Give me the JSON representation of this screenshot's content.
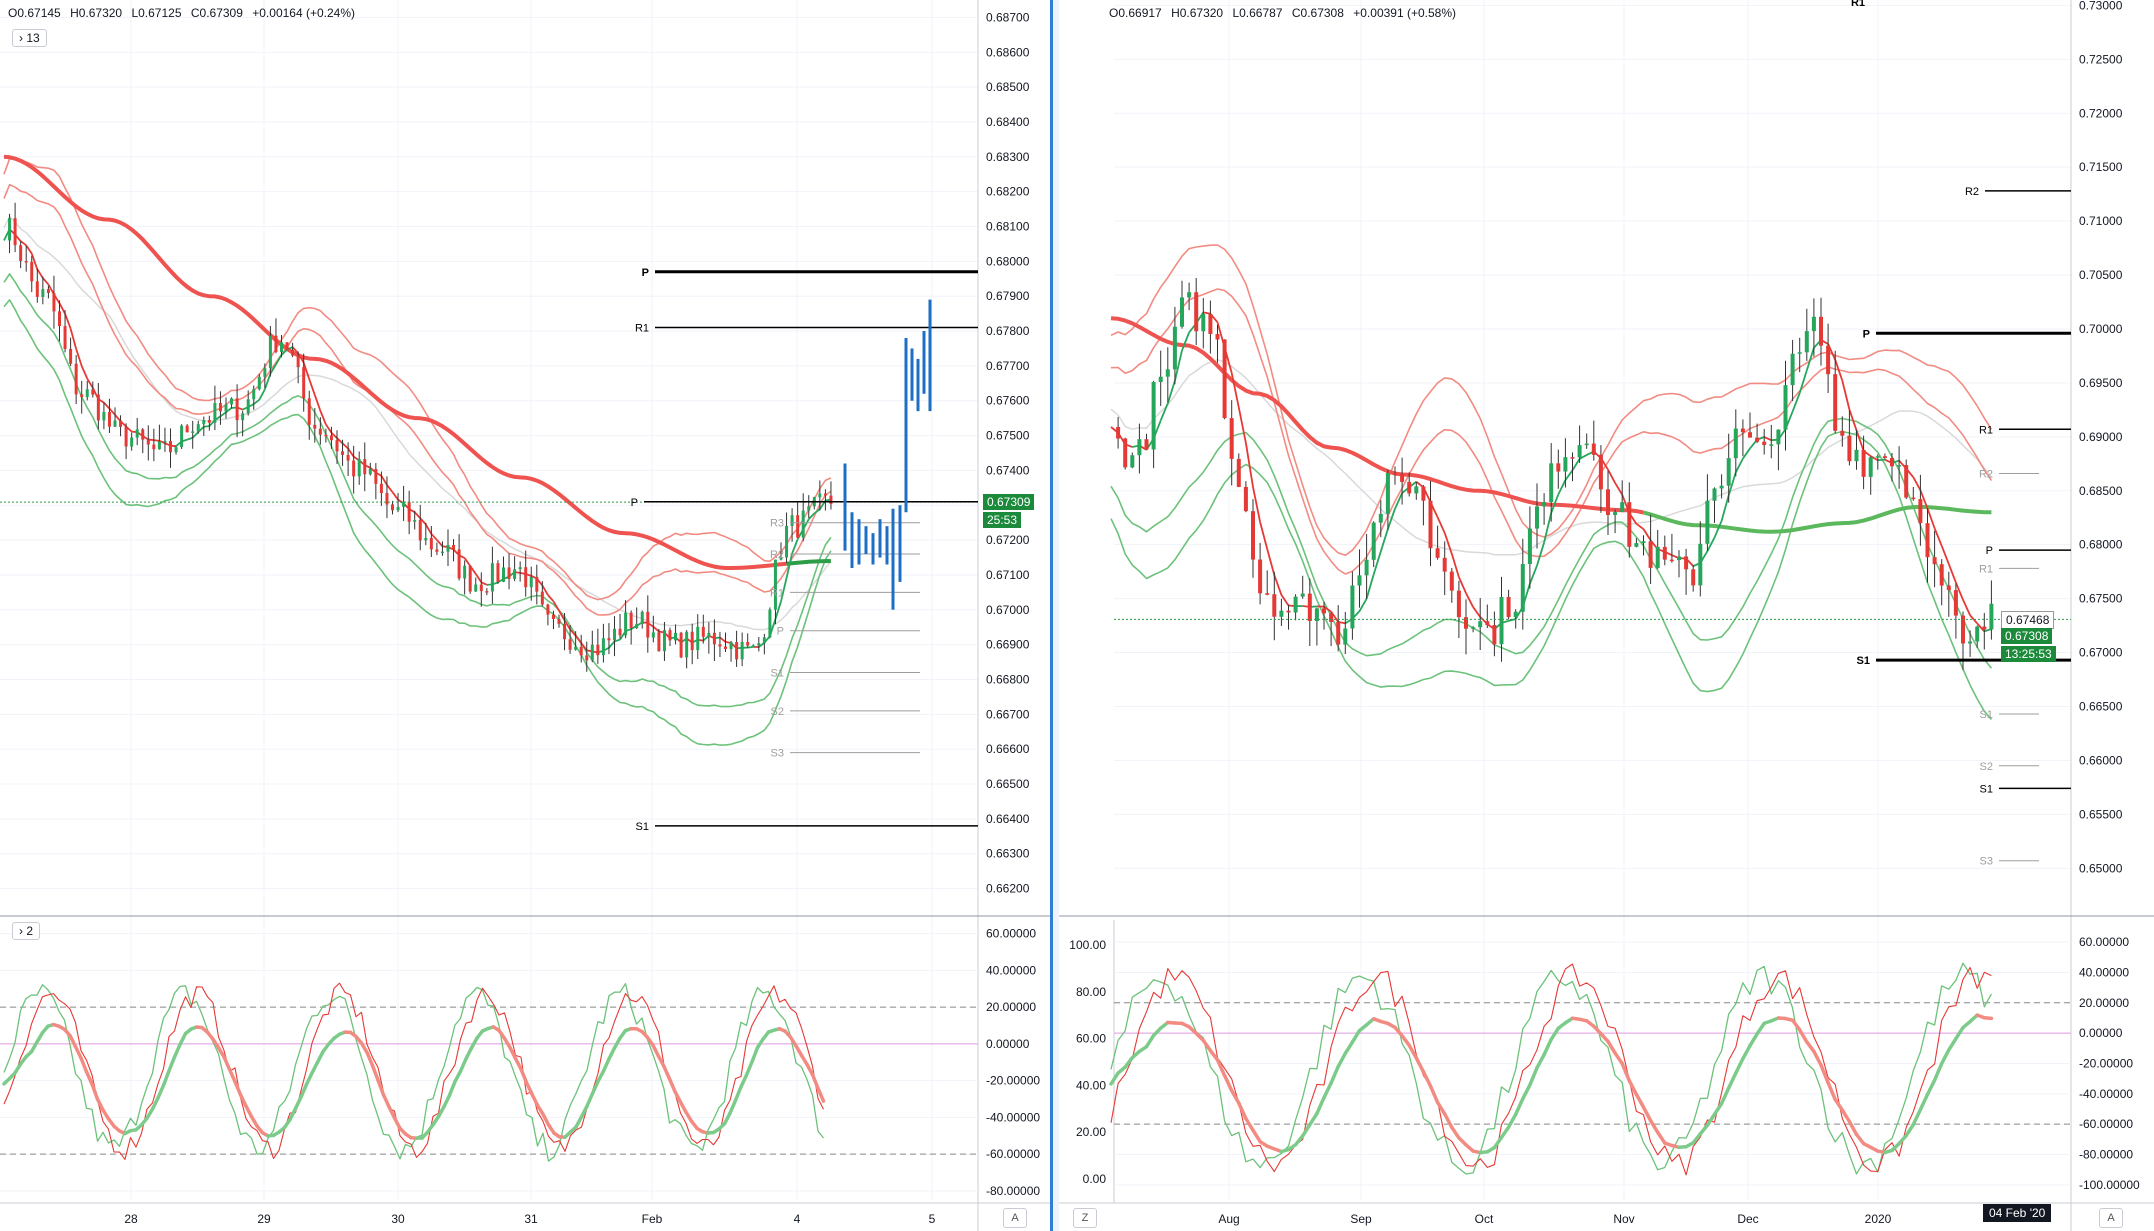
{
  "left_chart": {
    "legend": {
      "open": "O0.67145",
      "high": "H0.67320",
      "low": "L0.67125",
      "close": "C0.67309",
      "change": "+0.00164 (+0.24%)"
    },
    "collapse_label": "13",
    "osc_collapse_label": "2",
    "price_axis": [
      "0.68700",
      "0.68600",
      "0.68500",
      "0.68400",
      "0.68300",
      "0.68200",
      "0.68100",
      "0.68000",
      "0.67900",
      "0.67800",
      "0.67700",
      "0.67600",
      "0.67500",
      "0.67400",
      "0.67300",
      "0.67200",
      "0.67100",
      "0.67000",
      "0.66900",
      "0.66800",
      "0.66700",
      "0.66600",
      "0.66500",
      "0.66400",
      "0.66300",
      "0.66200"
    ],
    "osc_axis": [
      "60.00000",
      "40.00000",
      "20.00000",
      "0.00000",
      "-20.00000",
      "-40.00000",
      "-60.00000",
      "-80.00000"
    ],
    "time_axis": [
      "28",
      "29",
      "30",
      "31",
      "Feb",
      "4",
      "5"
    ],
    "last_price": "0.67309",
    "countdown": "25:53",
    "axis_mode_label": "A",
    "pivot_labels": {
      "p": "P",
      "r1": "R1",
      "s1": "S1",
      "p_small": "P",
      "r1_small": "R1",
      "r2_small": "R2",
      "r3_small": "R3",
      "s1_small": "S1",
      "s2_small": "S2",
      "s3_small": "S3"
    }
  },
  "right_chart": {
    "legend": {
      "open": "O0.66917",
      "high": "H0.67320",
      "low": "L0.66787",
      "close": "C0.67308",
      "change": "+0.00391 (+0.58%)"
    },
    "price_axis": [
      "0.73000",
      "0.72500",
      "0.72000",
      "0.71500",
      "0.71000",
      "0.70500",
      "0.70000",
      "0.69500",
      "0.69000",
      "0.68500",
      "0.68000",
      "0.67500",
      "0.67000",
      "0.66500",
      "0.66000",
      "0.65500",
      "0.65000"
    ],
    "osc_left_axis": [
      "100.00",
      "80.00",
      "60.00",
      "40.00",
      "20.00",
      "0.00"
    ],
    "osc_right_axis": [
      "60.00000",
      "40.00000",
      "20.00000",
      "0.00000",
      "-20.00000",
      "-40.00000",
      "-60.00000",
      "-80.00000",
      "-100.00000"
    ],
    "time_axis": [
      "Aug",
      "Sep",
      "Oct",
      "Nov",
      "Dec",
      "2020"
    ],
    "date_tag": "04 Feb '20",
    "price_tag_high": "0.67468",
    "last_price": "0.67308",
    "countdown": "13:25:53",
    "axis_mode_left": "Z",
    "axis_mode_right": "A",
    "pivot_labels": {
      "r1_top": "R1",
      "r2": "R2",
      "p": "P",
      "r1": "R1",
      "s1": "S1",
      "r1_small": "R1",
      "r2_small": "R2",
      "p_small": "P",
      "r1_small2": "R1",
      "s1_small": "S1",
      "s2_small": "S2",
      "s3_small": "S3"
    }
  },
  "colors": {
    "bull": "#26a65b",
    "bear": "#e53935",
    "ma_red": "#ef5350",
    "band_red": "#f28b82",
    "band_green": "#6cc27a",
    "ma_grey": "#d9d9d9",
    "pivot_black": "#000000",
    "pivot_grey": "#9e9e9e",
    "projection": "#1e6fc4",
    "price_tag_green": "#1b8a3a",
    "dotted_green": "#2e9d47"
  },
  "chart_data": [
    {
      "type": "candlestick",
      "timeframe": "hourly",
      "x": [
        "28",
        "29",
        "30",
        "31",
        "Feb",
        "4",
        "5"
      ],
      "ylim": [
        0.6615,
        0.6875
      ],
      "last_close": 0.67309,
      "pivots": {
        "P": 0.6797,
        "R1": 0.6781,
        "S1": 0.6638,
        "R3_small": 0.6725,
        "R2_small": 0.6716,
        "R1_small": 0.6705,
        "P_small": 0.6694,
        "S1_small": 0.6682,
        "S2_small": 0.6671,
        "S3_small": 0.6659
      },
      "oscillator": {
        "ylim": [
          -85,
          55
        ],
        "levels": [
          20,
          0,
          -60
        ]
      }
    },
    {
      "type": "candlestick",
      "timeframe": "daily",
      "x": [
        "Aug",
        "Sep",
        "Oct",
        "Nov",
        "Dec",
        "2020"
      ],
      "ylim": [
        0.6465,
        0.7305
      ],
      "last_close": 0.67308,
      "pivots": {
        "R2": 0.7128,
        "P": 0.6996,
        "R1": 0.6907,
        "P_weekly": 0.6795,
        "S1": 0.6693,
        "S1_low": 0.6574
      },
      "oscillator": {
        "ylim": [
          -5,
          105
        ],
        "levels": [
          80,
          20
        ]
      }
    }
  ]
}
